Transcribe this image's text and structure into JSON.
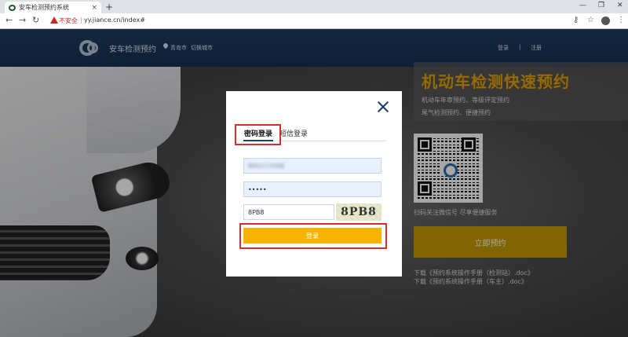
{
  "browser": {
    "tab_title": "安车检测预约系统",
    "tab_close": "×",
    "new_tab": "+",
    "minimize": "—",
    "maximize": "❐",
    "close_window": "✕",
    "back": "←",
    "forward": "→",
    "reload": "↻",
    "security_label": "不安全",
    "separator": "|",
    "url": "yy.jiance.cn/index#",
    "key_icon": "⚷",
    "star_icon": "☆",
    "menu_icon": "⋮"
  },
  "header": {
    "site_name": "安车检测预约",
    "city": "青岛市",
    "switch_city": "切换城市",
    "login": "登录",
    "divider": "|",
    "register": "注册"
  },
  "promo": {
    "title": "机动车检测快速预约",
    "line1": "机动车年审预约、等级评定预约",
    "line2": "尾气检测预约、便捷预约",
    "qr_caption": "扫码关注微信号 尽享便捷服务",
    "book_button": "立即预约",
    "download1": "下载《预约系统操作手册（检测站）.doc》",
    "download2": "下载《预约系统操作手册（车主）.doc》"
  },
  "modal": {
    "tab_password": "密码登录",
    "tab_sms": "短信登录",
    "password_value": "•••••",
    "captcha_value": "8PB8",
    "captcha_image_text": "8PB8",
    "login_button": "登录"
  },
  "colors": {
    "header_bg": "#1f3e63",
    "accent_yellow": "#f4b400",
    "promo_title": "#e7a400",
    "highlight_red": "#d32f2f"
  }
}
